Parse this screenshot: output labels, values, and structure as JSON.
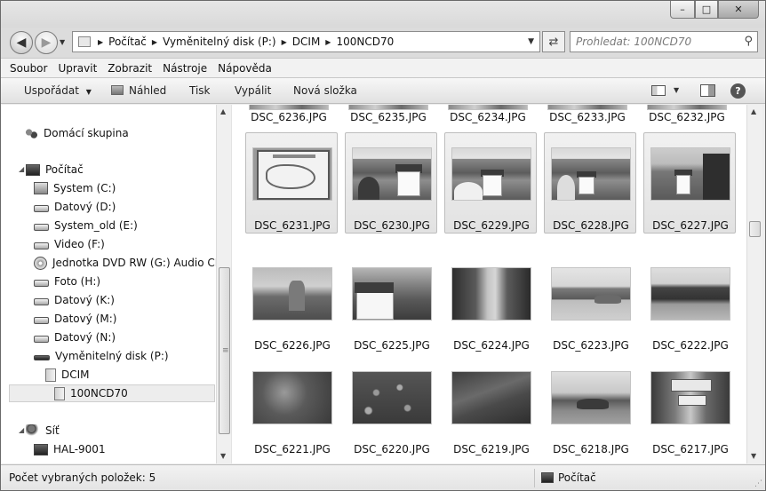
{
  "window": {
    "minimize_glyph": "–",
    "maximize_glyph": "□",
    "close_glyph": "✕"
  },
  "address_bar": {
    "crumbs": [
      "Počítač",
      "Vyměnitelný disk (P:)",
      "DCIM",
      "100NCD70"
    ]
  },
  "search": {
    "placeholder": "Prohledat: 100NCD70"
  },
  "menu": [
    "Soubor",
    "Upravit",
    "Zobrazit",
    "Nástroje",
    "Nápověda"
  ],
  "toolbar": {
    "organize": "Uspořádat",
    "preview": "Náhled",
    "print": "Tisk",
    "burn": "Vypálit",
    "new_folder": "Nová složka"
  },
  "nav_tree": {
    "homegroup": "Domácí skupina",
    "computer": "Počítač",
    "drives": [
      "System (C:)",
      "Datový (D:)",
      "System_old (E:)",
      "Video (F:)",
      "Jednotka DVD RW (G:) Audio CD",
      "Foto (H:)",
      "Datový (K:)",
      "Datový (M:)",
      "Datový (N:)",
      "Vyměnitelný disk (P:)"
    ],
    "dcim": "DCIM",
    "current_folder": "100NCD70",
    "network": "Síť",
    "network_pc": "HAL-9001"
  },
  "files": {
    "top_row": [
      "DSC_6236.JPG",
      "DSC_6235.JPG",
      "DSC_6234.JPG",
      "DSC_6233.JPG",
      "DSC_6232.JPG"
    ],
    "row1": [
      "DSC_6231.JPG",
      "DSC_6230.JPG",
      "DSC_6229.JPG",
      "DSC_6228.JPG",
      "DSC_6227.JPG"
    ],
    "row2": [
      "DSC_6226.JPG",
      "DSC_6225.JPG",
      "DSC_6224.JPG",
      "DSC_6223.JPG",
      "DSC_6222.JPG"
    ],
    "row3": [
      "DSC_6221.JPG",
      "DSC_6220.JPG",
      "DSC_6219.JPG",
      "DSC_6218.JPG",
      "DSC_6217.JPG"
    ]
  },
  "status": {
    "selected_count_text": "Počet vybraných položek: 5",
    "location": "Počítač"
  }
}
